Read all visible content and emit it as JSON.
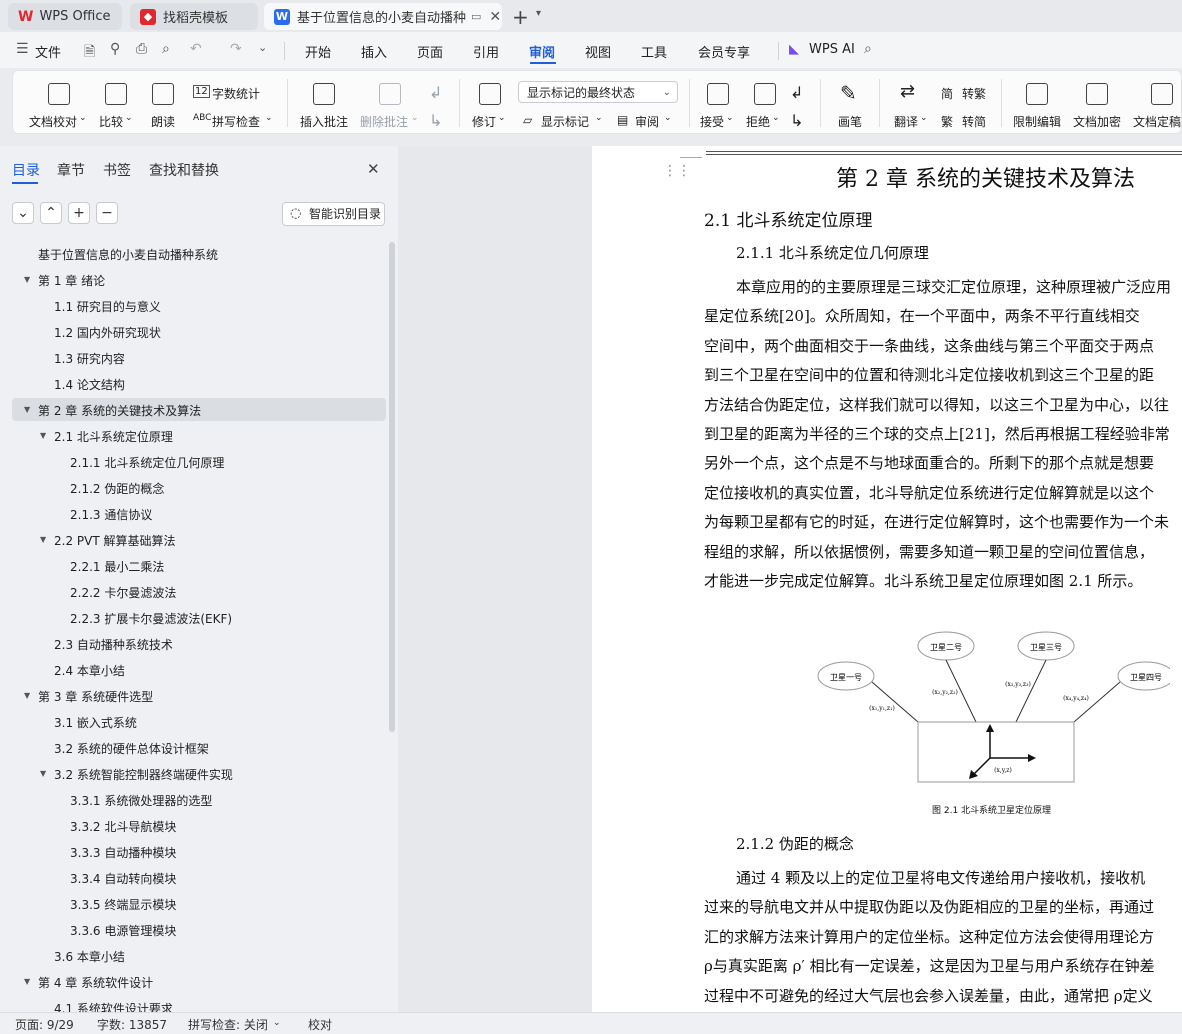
{
  "titlebar": {
    "tabs": [
      {
        "label": "WPS Office",
        "logo": "W"
      },
      {
        "label": "找稻壳模板",
        "logo": "◆"
      },
      {
        "label": "基于位置信息的小麦自动播种系",
        "logo": "W"
      }
    ],
    "new_tab": "+",
    "colors": {
      "wps_red": "#e0282e",
      "wps_blue": "#2b6cf0",
      "accent": "#1f5fd9"
    }
  },
  "menubar": {
    "file": "文件",
    "items": [
      "开始",
      "插入",
      "页面",
      "引用",
      "审阅",
      "视图",
      "工具",
      "会员专享"
    ],
    "active": "审阅",
    "ai": "WPS AI"
  },
  "ribbon": {
    "proofread": "文档校对",
    "compare": "比较",
    "read_aloud": "朗读",
    "word_count": "字数统计",
    "spell_check": "拼写检查",
    "insert_comment": "插入批注",
    "delete_comment": "删除批注",
    "revise": "修订",
    "markup_state": "显示标记的最终状态",
    "show_markup": "显示标记",
    "review": "审阅",
    "accept": "接受",
    "reject": "拒绝",
    "pen": "画笔",
    "translate": "翻译",
    "to_traditional": "转繁",
    "to_simplified": "转简",
    "restrict_edit": "限制编辑",
    "encrypt": "文档加密",
    "finalize": "文档定稿"
  },
  "nav": {
    "tabs": [
      "目录",
      "章节",
      "书签",
      "查找和替换"
    ],
    "smart_btn": "智能识别目录",
    "toc": [
      {
        "text": "基于位置信息的小麦自动播种系统",
        "level": 0,
        "caret": false
      },
      {
        "text": "第 1 章  绪论",
        "level": 0,
        "caret": true
      },
      {
        "text": "1.1  研究目的与意义",
        "level": 1,
        "caret": false
      },
      {
        "text": "1.2  国内外研究现状",
        "level": 1,
        "caret": false
      },
      {
        "text": "1.3  研究内容",
        "level": 1,
        "caret": false
      },
      {
        "text": "1.4  论文结构",
        "level": 1,
        "caret": false
      },
      {
        "text": "第 2 章  系统的关键技术及算法",
        "level": 0,
        "caret": true
      },
      {
        "text": "2.1  北斗系统定位原理",
        "level": 1,
        "caret": true
      },
      {
        "text": "2.1.1  北斗系统定位几何原理",
        "level": 2,
        "caret": false
      },
      {
        "text": "2.1.2  伪距的概念",
        "level": 2,
        "caret": false
      },
      {
        "text": "2.1.3  通信协议",
        "level": 2,
        "caret": false
      },
      {
        "text": "2.2    PVT 解算基础算法",
        "level": 1,
        "caret": true
      },
      {
        "text": "2.2.1  最小二乘法",
        "level": 2,
        "caret": false
      },
      {
        "text": "2.2.2  卡尔曼滤波法",
        "level": 2,
        "caret": false
      },
      {
        "text": "2.2.3  扩展卡尔曼滤波法(EKF)",
        "level": 2,
        "caret": false
      },
      {
        "text": "2.3  自动播种系统技术",
        "level": 1,
        "caret": false
      },
      {
        "text": "2.4  本章小结",
        "level": 1,
        "caret": false
      },
      {
        "text": "第 3 章  系统硬件选型",
        "level": 0,
        "caret": true
      },
      {
        "text": "3.1  嵌入式系统",
        "level": 1,
        "caret": false
      },
      {
        "text": "3.2  系统的硬件总体设计框架",
        "level": 1,
        "caret": false
      },
      {
        "text": "3.2  系统智能控制器终端硬件实现",
        "level": 1,
        "caret": true
      },
      {
        "text": "3.3.1  系统微处理器的选型",
        "level": 2,
        "caret": false
      },
      {
        "text": "3.3.2  北斗导航模块",
        "level": 2,
        "caret": false
      },
      {
        "text": "3.3.3  自动播种模块",
        "level": 2,
        "caret": false
      },
      {
        "text": "3.3.4  自动转向模块",
        "level": 2,
        "caret": false
      },
      {
        "text": "3.3.5  终端显示模块",
        "level": 2,
        "caret": false
      },
      {
        "text": "3.3.6  电源管理模块",
        "level": 2,
        "caret": false
      },
      {
        "text": "3.6  本章小结",
        "level": 1,
        "caret": false
      },
      {
        "text": "第 4 章  系统软件设计",
        "level": 0,
        "caret": true
      },
      {
        "text": "4.1  系统软件设计要求",
        "level": 1,
        "caret": false
      }
    ],
    "selected_index": 6
  },
  "doc": {
    "chapter_title": "第 2 章  系统的关键技术及算法",
    "section": "2.1  北斗系统定位原理",
    "subsection": "2.1.1  北斗系统定位几何原理",
    "paragraph": [
      "本章应用的的主要原理是三球交汇定位原理，这种原理被广泛应用",
      "星定位系统[20]。众所周知，在一个平面中，两条不平行直线相交",
      "空间中，两个曲面相交于一条曲线，这条曲线与第三个平面交于两点",
      "到三个卫星在空间中的位置和待测北斗定位接收机到这三个卫星的距",
      "方法结合伪距定位，这样我们就可以得知，以这三个卫星为中心，以往",
      "到卫星的距离为半径的三个球的交点上[21]，然后再根据工程经验非常",
      "另外一个点，这个点是不与地球面重合的。所剩下的那个点就是想要",
      "定位接收机的真实位置，北斗导航定位系统进行定位解算就是以这个",
      "为每颗卫星都有它的时延，在进行定位解算时，这个也需要作为一个未",
      "程组的求解，所以依据惯例，需要多知道一颗卫星的空间位置信息，",
      "才能进一步完成定位解算。北斗系统卫星定位原理如图  2.1  所示。"
    ],
    "figure": {
      "sat1": "卫星一号",
      "sat2": "卫星二号",
      "sat3": "卫星三号",
      "sat4": "卫星四号",
      "c1": "(x₁,y₁,z₁)",
      "c2": "(x₂,y₂,z₂)",
      "c3": "(x₃,y₃,z₃)",
      "c4": "(x₄,y₄,z₄)",
      "origin": "(x,y,z)",
      "caption": "图 2.1 北斗系统卫星定位原理"
    },
    "subsection2": "2.1.2  伪距的概念",
    "paragraph2": [
      "通过  4  颗及以上的定位卫星将电文传递给用户接收机，接收机",
      "过来的导航电文并从中提取伪距以及伪距相应的卫星的坐标，再通过",
      "汇的求解方法来计算用户的定位坐标。这种定位方法会使得用理论方",
      "ρ与真实距离  ρ′ 相比有一定误差，这是因为卫星与用户系统存在钟差",
      "过程中不可避免的经过大气层也会参入误差量，由此，通常把  ρ定义"
    ]
  },
  "status": {
    "page": "页面: 9/29",
    "words": "字数: 13857",
    "spell": "拼写检查: 关闭",
    "proof": "校对"
  }
}
